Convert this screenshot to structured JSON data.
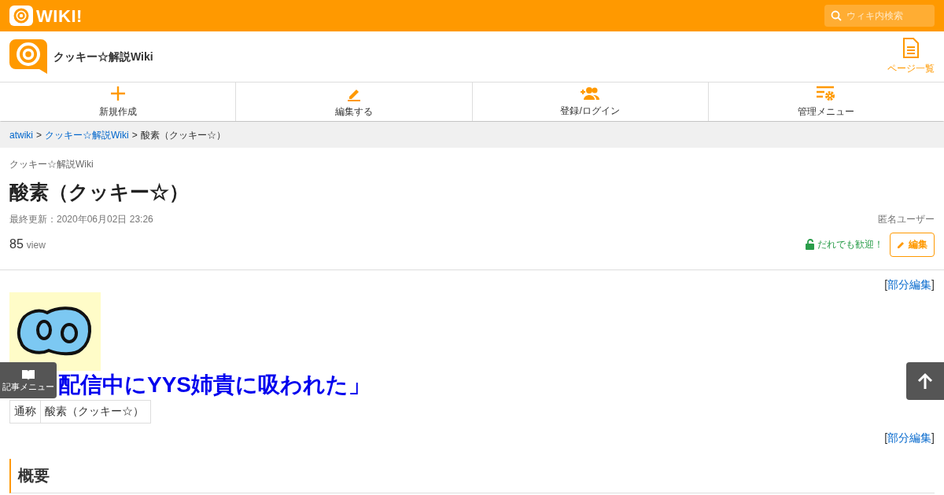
{
  "topbar": {
    "logo": "WIKI!",
    "search": {
      "placeholder": "ウィキ内検索"
    }
  },
  "site": {
    "title": "クッキー☆解説Wiki",
    "page_list": "ページ一覧"
  },
  "nav": [
    {
      "label": "新規作成",
      "kind": "plus"
    },
    {
      "label": "編集する",
      "kind": "pencil"
    },
    {
      "label": "登録/ログイン",
      "kind": "user"
    },
    {
      "label": "管理メニュー",
      "kind": "admin"
    }
  ],
  "breadcrumb": [
    {
      "text": "atwiki",
      "link": true
    },
    {
      "text": ">",
      "link": false
    },
    {
      "text": "クッキー☆解説Wiki",
      "link": true
    },
    {
      "text": ">",
      "link": false
    },
    {
      "text": "酸素（クッキー☆）",
      "link": false
    }
  ],
  "page": {
    "wiki_name": "クッキー☆解説Wiki",
    "title": "酸素（クッキー☆）",
    "updated": "最終更新：2020年06月02日 23:26",
    "author": "匿名ユーザー",
    "views": "85",
    "views_unit": "view",
    "welcome": "だれでも歓迎！",
    "edit": "編集"
  },
  "section_edit_1": [
    "[",
    "部分編集",
    "]"
  ],
  "image": {
    "kind": "picture"
  },
  "quote": "配信中にYYS姉貴に吸われた」",
  "info_table": [
    {
      "label": "通称",
      "value": "酸素（クッキー☆）"
    }
  ],
  "section_edit_2": [
    "[",
    "部分編集",
    "]"
  ],
  "heading": "概要",
  "article_menu": "記事メニュー"
}
